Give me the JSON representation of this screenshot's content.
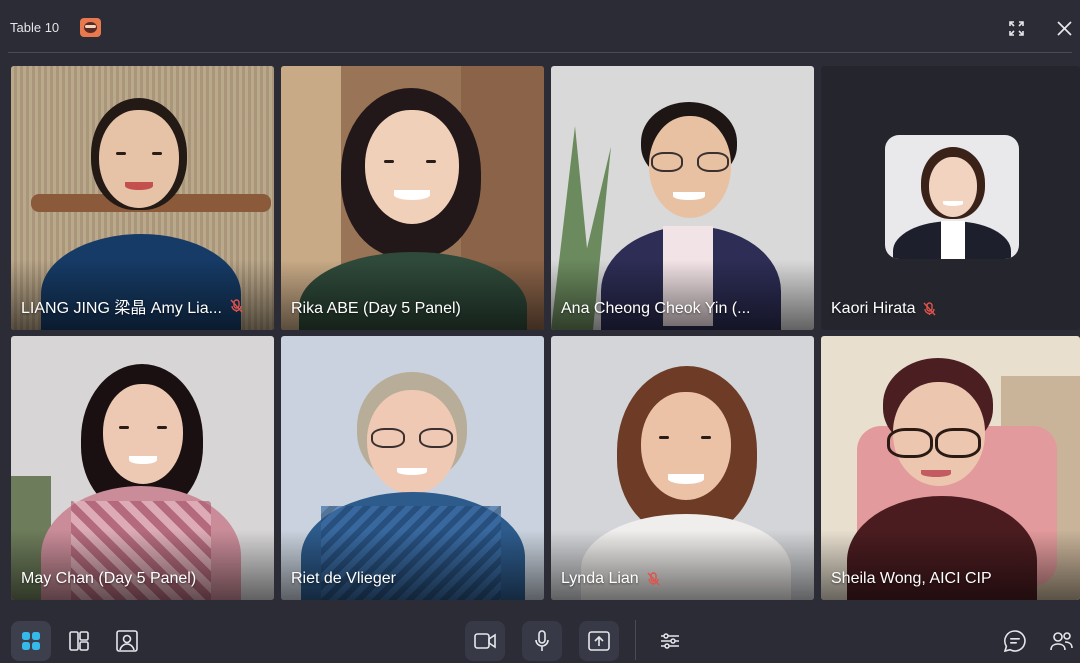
{
  "window": {
    "title": "Table 10"
  },
  "participants": [
    {
      "name": "LIANG JING 梁晶 Amy Lia...",
      "muted": true
    },
    {
      "name": "Rika ABE (Day 5 Panel)",
      "muted": false
    },
    {
      "name": "Ana Cheong Cheok Yin (...",
      "muted": false
    },
    {
      "name": "Kaori Hirata",
      "muted": true
    },
    {
      "name": "May Chan (Day 5 Panel)",
      "muted": false
    },
    {
      "name": "Riet de Vlieger",
      "muted": false
    },
    {
      "name": "Lynda Lian",
      "muted": true
    },
    {
      "name": "Sheila Wong, AICI CIP",
      "muted": false
    }
  ],
  "icons": {
    "fullscreen": "expand-icon",
    "close": "close-icon",
    "grid_view": "grid-view-icon",
    "speaker_view": "speaker-view-icon",
    "portrait_view": "portrait-view-icon",
    "camera": "video-camera-icon",
    "microphone": "microphone-icon",
    "share": "share-screen-icon",
    "settings": "sliders-icon",
    "chat": "chat-icon",
    "people": "participants-icon",
    "mic_off": "mic-off-icon"
  },
  "colors": {
    "background": "#2b2c36",
    "accent": "#35b8ea",
    "muted_mic": "#e0534a",
    "text": "#ffffff"
  }
}
